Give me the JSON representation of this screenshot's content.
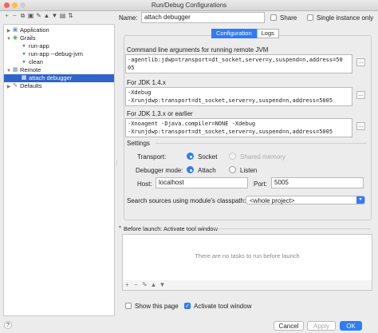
{
  "window": {
    "title": "Run/Debug Configurations"
  },
  "toolbar": {
    "icons": [
      "add-icon",
      "remove-icon",
      "copy-icon",
      "save-icon",
      "wrench-icon",
      "move-up-icon",
      "move-down-icon",
      "folder-icon",
      "sort-icon"
    ],
    "glyphs": [
      "+",
      "−",
      "⧉",
      "▣",
      "✎",
      "▲",
      "▼",
      "▤",
      "⇅"
    ]
  },
  "tree": {
    "items": [
      {
        "label": "Application",
        "level": 0,
        "expanded": false,
        "icon": "application-icon",
        "glyph": "▣",
        "color": "#6b8fb3"
      },
      {
        "label": "Grails",
        "level": 0,
        "expanded": true,
        "icon": "grails-icon",
        "glyph": "◉",
        "color": "#5aa84a"
      },
      {
        "label": "run-app",
        "level": 1,
        "icon": "grails-run-icon",
        "glyph": "●",
        "color": "#5aa84a"
      },
      {
        "label": "run-app --debug-jvm",
        "level": 1,
        "icon": "grails-run-icon",
        "glyph": "●",
        "color": "#5aa84a"
      },
      {
        "label": "clean",
        "level": 1,
        "icon": "grails-run-icon",
        "glyph": "●",
        "color": "#5aa84a"
      },
      {
        "label": "Remote",
        "level": 0,
        "expanded": true,
        "icon": "remote-icon",
        "glyph": "▦",
        "color": "#6b8fb3"
      },
      {
        "label": "attach debugger",
        "level": 1,
        "selected": true,
        "icon": "remote-config-icon",
        "glyph": "▦",
        "color": "#ffffff"
      },
      {
        "label": "Defaults",
        "level": 0,
        "expanded": false,
        "icon": "defaults-icon",
        "glyph": "✎",
        "color": "#777777"
      }
    ]
  },
  "form": {
    "name_label": "Name:",
    "name_value": "attach debugger",
    "share_label": "Share",
    "single_instance_label": "Single instance only"
  },
  "tabs": [
    "Configuration",
    "Logs"
  ],
  "config": {
    "cmd_label": "Command line arguments for running remote JVM",
    "cmd_value": "-agentlib:jdwp=transport=dt_socket,server=y,suspend=n,address=50\n05",
    "jdk14_label": "For JDK 1.4.x",
    "jdk14_value": "-Xdebug\n-Xrunjdwp:transport=dt_socket,server=y,suspend=n,address=5005",
    "jdk13_label": "For JDK 1.3.x or earlier",
    "jdk13_value": "-Xnoagent -Djava.compiler=NONE -Xdebug\n-Xrunjdwp:transport=dt_socket,server=y,suspend=n,address=5005",
    "dots": "...",
    "settings_label": "Settings",
    "transport_label": "Transport:",
    "socket_label": "Socket",
    "shared_memory_label": "Shared memory",
    "debugger_mode_label": "Debugger mode:",
    "attach_label": "Attach",
    "listen_label": "Listen",
    "host_label": "Host:",
    "host_value": "localhost",
    "port_label": "Port:",
    "port_value": "5005",
    "search_sources_label": "Search sources using module's classpath:",
    "search_sources_value": "<whole project>"
  },
  "before_launch": {
    "label": "Before launch: Activate tool window",
    "empty_text": "There are no tasks to run before launch",
    "tools": [
      "+",
      "−",
      "✎",
      "▲",
      "▼"
    ]
  },
  "options": {
    "show_this_page": "Show this page",
    "activate_tool_window": "Activate tool window"
  },
  "buttons": {
    "cancel": "Cancel",
    "apply": "Apply",
    "ok": "OK"
  },
  "colors": {
    "accent": "#2f7cf6",
    "selection": "#2f65ca"
  }
}
